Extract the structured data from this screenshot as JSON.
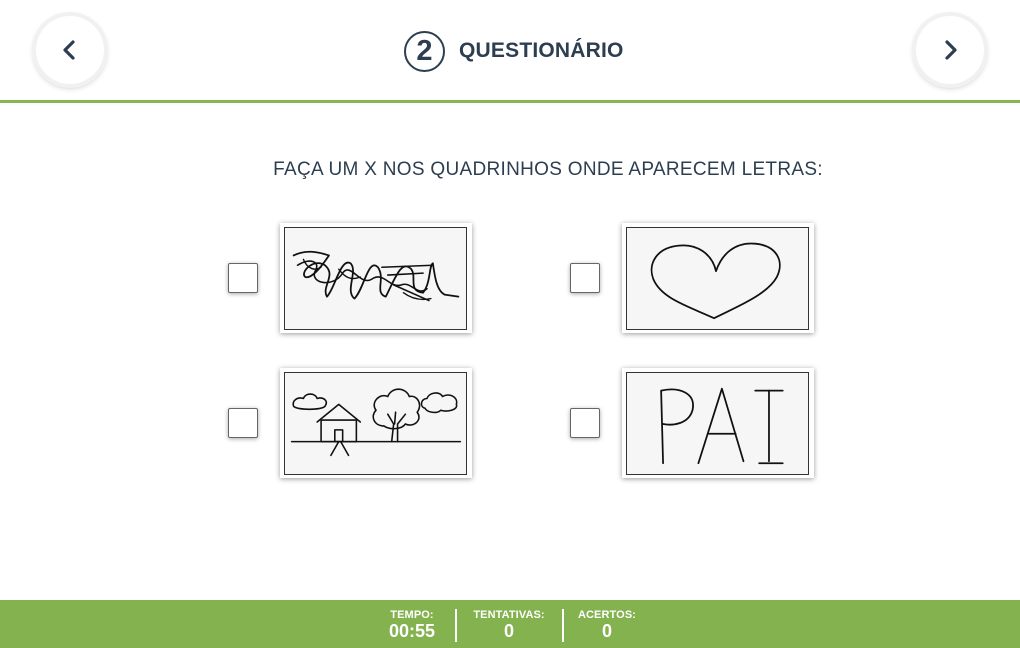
{
  "header": {
    "step_number": "2",
    "title": "QUESTIONÁRIO",
    "prev_icon": "chevron-left-icon",
    "next_icon": "chevron-right-icon"
  },
  "instruction": "FAÇA UM X NOS QUADRINHOS ONDE APARECEM LETRAS:",
  "options": [
    {
      "id": "scribble",
      "image": "scribble-drawing",
      "checked": false
    },
    {
      "id": "heart",
      "image": "heart-drawing",
      "checked": false
    },
    {
      "id": "landscape",
      "image": "house-tree-clouds-drawing",
      "checked": false
    },
    {
      "id": "word",
      "image": "handwritten-word",
      "text": "PAI",
      "checked": false
    }
  ],
  "footer": {
    "time_label": "TEMPO:",
    "time_value": "00:55",
    "attempts_label": "TENTATIVAS:",
    "attempts_value": "0",
    "hits_label": "ACERTOS:",
    "hits_value": "0"
  },
  "colors": {
    "accent_green": "#84b24f",
    "header_line": "#8ab553",
    "text_dark": "#2d3e50"
  }
}
